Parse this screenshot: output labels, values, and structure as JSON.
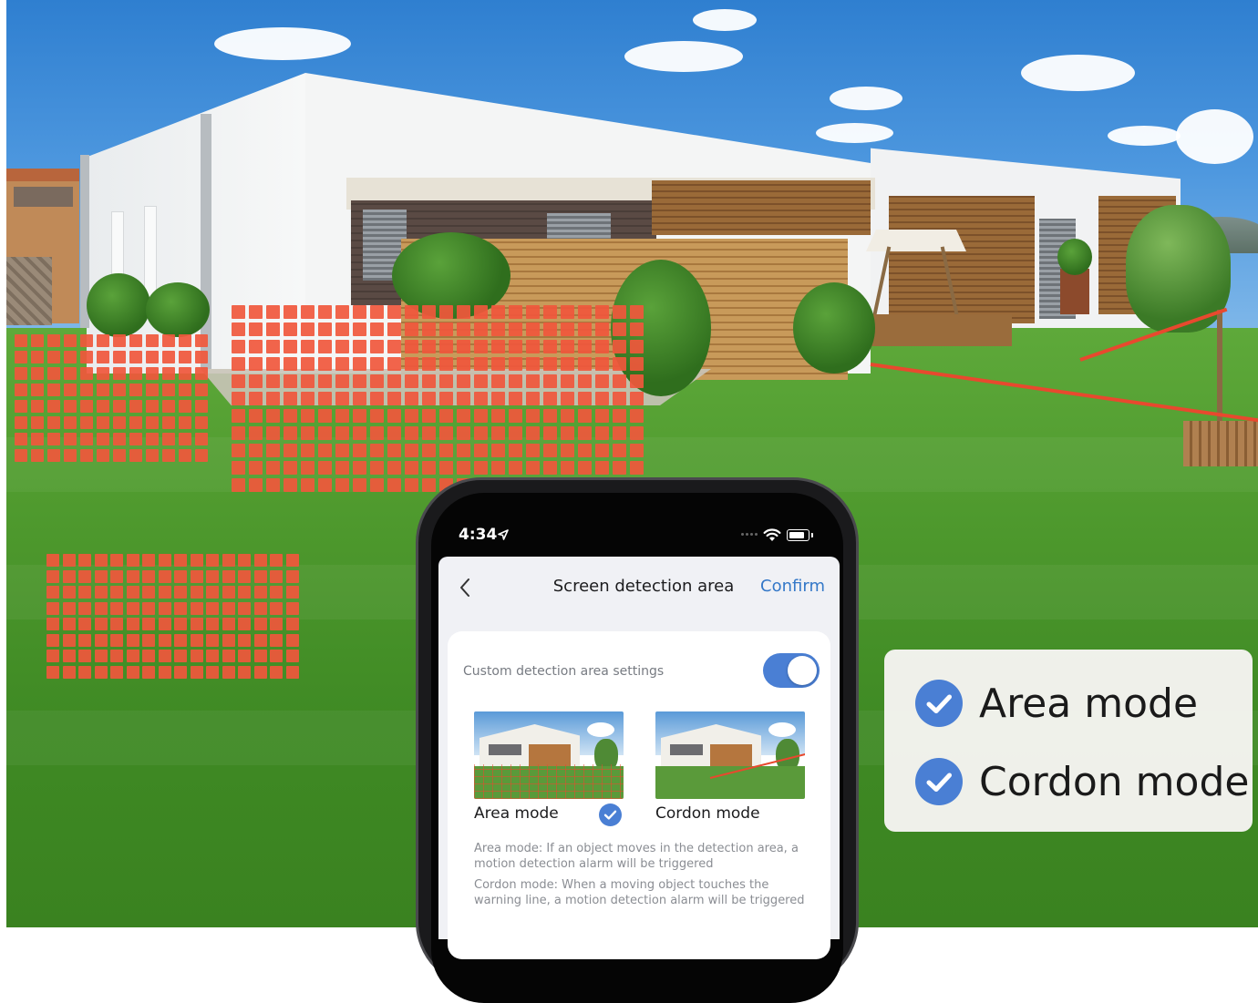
{
  "colors": {
    "detection_red": "#f0573c",
    "accent_blue": "#4a7fd4",
    "confirm_blue": "#3478c8"
  },
  "phone": {
    "status_time": "4:34",
    "icons": [
      "location-arrow-icon",
      "wifi-icon",
      "battery-icon"
    ],
    "nav": {
      "back_icon": "chevron-left-icon",
      "title": "Screen detection area",
      "confirm_label": "Confirm"
    },
    "settings": {
      "custom_area_label": "Custom detection area settings",
      "custom_area_enabled": true
    },
    "modes": [
      {
        "label": "Area mode",
        "selected": true
      },
      {
        "label": "Cordon mode",
        "selected": false
      }
    ],
    "descriptions": {
      "area": "Area mode: If an object moves in the detection area, a motion detection alarm will be triggered",
      "cordon": "Cordon mode: When a moving object touches the warning line, a motion detection alarm will be triggered"
    }
  },
  "feature_panel": {
    "items": [
      {
        "label": "Area mode",
        "icon": "check-circle-icon"
      },
      {
        "label": "Cordon mode",
        "icon": "check-circle-icon"
      }
    ]
  }
}
